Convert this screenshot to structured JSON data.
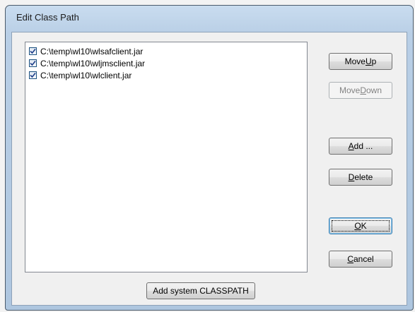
{
  "window": {
    "title": "Edit Class Path"
  },
  "classpath": {
    "items": [
      {
        "checked": true,
        "path": "C:\\temp\\wl10\\wlsafclient.jar"
      },
      {
        "checked": true,
        "path": "C:\\temp\\wl10\\wljmsclient.jar"
      },
      {
        "checked": true,
        "path": "C:\\temp\\wl10\\wlclient.jar"
      }
    ]
  },
  "buttons": {
    "move_up": {
      "pre": "Move ",
      "mn": "U",
      "post": "p",
      "enabled": true
    },
    "move_down": {
      "pre": "Move ",
      "mn": "D",
      "post": "own",
      "enabled": false
    },
    "add": {
      "pre": "",
      "mn": "A",
      "post": "dd ...",
      "enabled": true
    },
    "delete": {
      "pre": "",
      "mn": "D",
      "post": "elete",
      "enabled": true
    },
    "ok": {
      "pre": "",
      "mn": "O",
      "post": "K",
      "enabled": true,
      "default": true
    },
    "cancel": {
      "pre": "",
      "mn": "C",
      "post": "ancel",
      "enabled": true
    },
    "add_system_classpath": {
      "label": "Add system CLASSPATH",
      "enabled": true
    }
  },
  "colors": {
    "frame": "#b9cfe6",
    "client": "#f0f0f0",
    "checkmark": "#1e3f8a",
    "default_button_border": "#3c7fb1"
  },
  "icons": {
    "checkbox": "checkbox-checked-icon"
  }
}
